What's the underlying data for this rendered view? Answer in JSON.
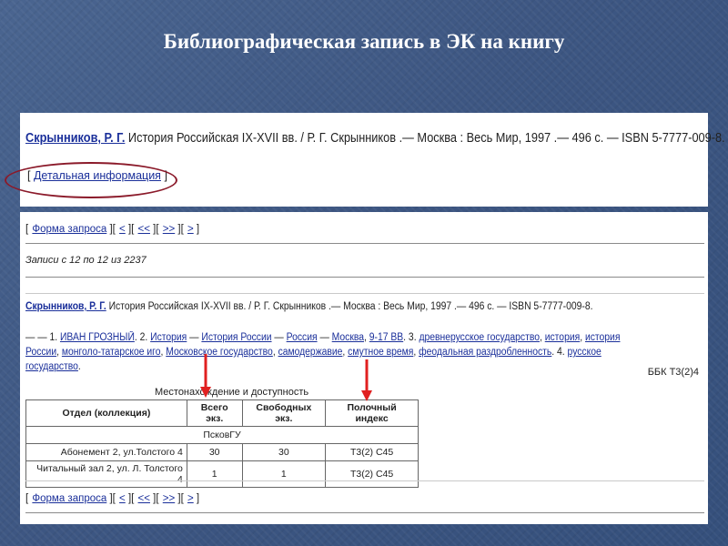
{
  "slide": {
    "title": "Библиографическая запись в ЭК на книгу"
  },
  "record_top": {
    "author": "Скрынников, Р. Г.",
    "text": " История Российская IX-XVII вв. / Р. Г. Скрынников .— Москва : Весь Мир, 1997 .— 496 с. — ISBN 5-7777-009-8.",
    "detail_link": "Детальная информация",
    "bracket_open": "[",
    "bracket_close": "]"
  },
  "nav": {
    "items": [
      "Форма запроса",
      "<",
      "<<",
      ">>",
      ">"
    ]
  },
  "records_count": "Записи с 12 по 12 из 2237",
  "record_bottom": {
    "author": "Скрынников, Р. Г.",
    "text": " История Российская IX-XVII вв. / Р. Г. Скрынников .— Москва : Весь Мир, 1997 .— 496 с. — ISBN 5-7777-009-8."
  },
  "subjects": {
    "prefix": "— — 1. ",
    "s1": "ИВАН ГРОЗНЫЙ",
    "n2": ". 2. ",
    "s2": "История",
    "dash1": " — ",
    "s3": "История России",
    "dash2": " — ",
    "s4": "Россия",
    "dash3": " — ",
    "s5": "Москва",
    "c1": ", ",
    "s6": "9-17 ВВ",
    "n3": ". 3. ",
    "s7": "древнерусское государство",
    "c2": ", ",
    "s8": "история",
    "c3": ", ",
    "s9": "история России",
    "c4": ", ",
    "s10": "монголо-татарское иго",
    "c5": ", ",
    "s11": "Московское государство",
    "c6": ", ",
    "s12": "самодержавие",
    "c7": ", ",
    "s13": "смутное время",
    "c8": ", ",
    "s14": "феодальная раздробленность",
    "n4": ". 4. ",
    "s15": "русское государство",
    "end": "."
  },
  "bbk": "ББК Т3(2)4",
  "holdings": {
    "title": "Местонахождение и доступность",
    "headers": [
      "Отдел (коллекция)",
      "Всего экз.",
      "Свободных экз.",
      "Полочный индекс"
    ],
    "library": "ПсковГУ",
    "rows": [
      {
        "dept": "Абонемент 2, ул.Толстого 4",
        "total": "30",
        "free": "30",
        "shelf": "Т3(2) С45"
      },
      {
        "dept": "Читальный зал 2, ул. Л. Толстого 4",
        "total": "1",
        "free": "1",
        "shelf": "Т3(2) С45"
      }
    ]
  },
  "colors": {
    "background": "#3d5682",
    "link": "#1a2f9a",
    "ellipse": "#8b1a2a",
    "arrow": "#e02020"
  }
}
